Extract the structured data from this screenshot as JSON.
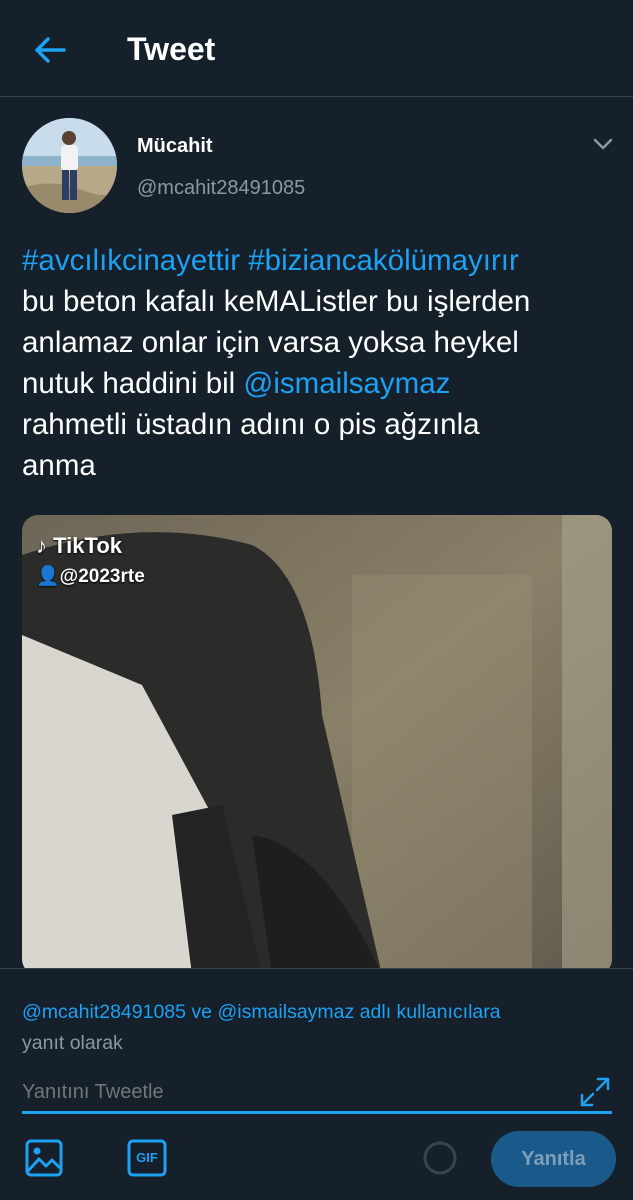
{
  "header": {
    "title": "Tweet",
    "back_icon": "arrow-left-icon"
  },
  "tweet": {
    "author_name": "Mücahit",
    "author_handle": "@mcahit28491085",
    "text_lines": [
      [
        {
          "t": "#avcılıkcinayettir",
          "link": true
        },
        {
          "t": "  ",
          "link": false
        },
        {
          "t": "#biziancakölümayırır",
          "link": true
        }
      ],
      [
        {
          "t": "bu beton kafalı keMAListler bu işlerden",
          "link": false
        }
      ],
      [
        {
          "t": "anlamaz onlar için varsa yoksa heykel",
          "link": false
        }
      ],
      [
        {
          "t": "nutuk haddini bil ",
          "link": false
        },
        {
          "t": "@ismailsaymaz",
          "link": true
        }
      ],
      [
        {
          "t": "rahmetli üstadın adını o pis ağzınla",
          "link": false
        }
      ],
      [
        {
          "t": "anma",
          "link": false
        }
      ]
    ],
    "media": {
      "watermark_brand": "TikTok",
      "watermark_user": "@2023rte"
    }
  },
  "reply": {
    "replying_to_prefix": "@mcahit28491085",
    "replying_to_joiner": " ve ",
    "replying_to_second": "@ismailsaymaz",
    "replying_to_suffix": " adlı kullanıcılara",
    "replying_to_line2": "yanıt olarak",
    "input_placeholder": "Yanıtını Tweetle",
    "gif_label": "GIF",
    "reply_button": "Yanıtla"
  },
  "colors": {
    "background": "#15202b",
    "accent": "#1da1f2",
    "muted": "#8899a6",
    "divider": "#38444d"
  }
}
